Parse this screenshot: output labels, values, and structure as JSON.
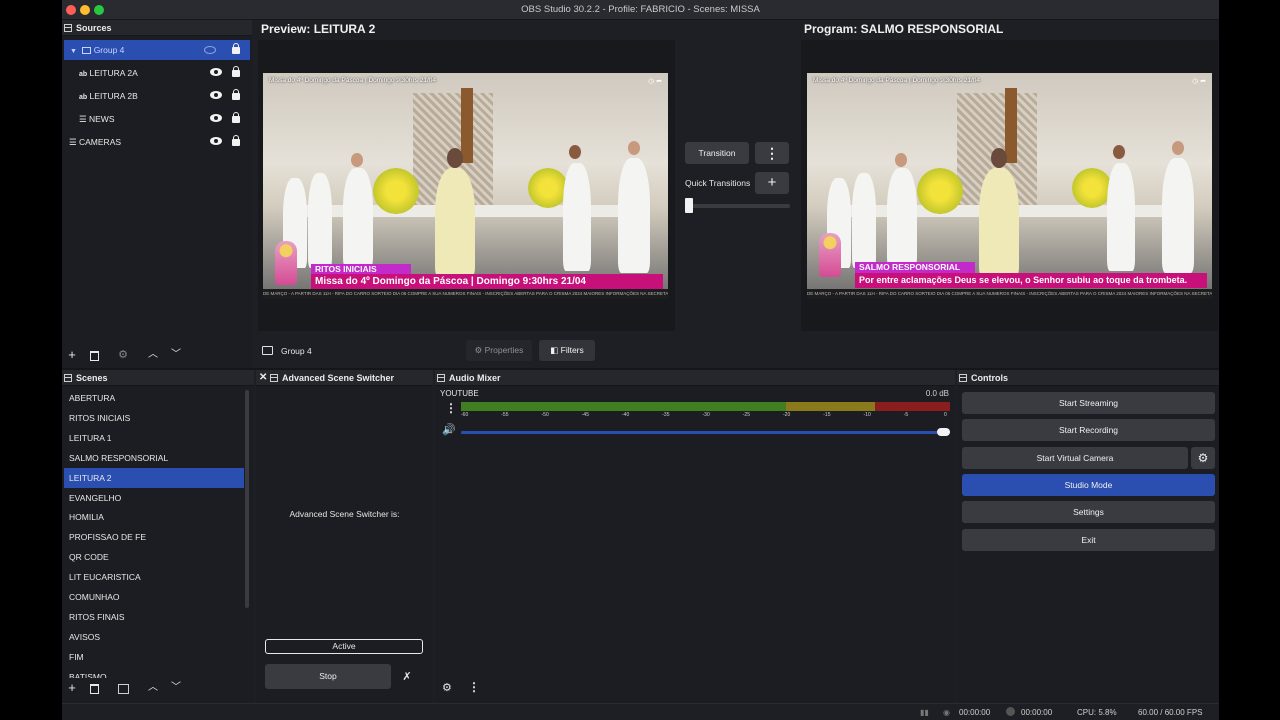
{
  "window": {
    "title": "OBS Studio 30.2.2 - Profile: FABRICIO - Scenes: MISSA"
  },
  "sources": {
    "header": "Sources",
    "items": [
      {
        "label": "Group 4",
        "type": "group"
      },
      {
        "label": "LEITURA 2A",
        "type": "text"
      },
      {
        "label": "LEITURA 2B",
        "type": "text"
      },
      {
        "label": "NEWS",
        "type": "list"
      },
      {
        "label": "CAMERAS",
        "type": "list"
      }
    ]
  },
  "preview": {
    "label": "Preview: LEITURA 2"
  },
  "program": {
    "label": "Program: SALMO RESPONSORIAL"
  },
  "video": {
    "stream_title": "Missa do 4º Domingo da Páscoa | Domingo 9:30hrs 21/04",
    "preview_bar_small": "RITOS INICIAIS",
    "preview_bar_big": "Missa do 4º Domingo da Páscoa | Domingo 9:30hrs 21/04",
    "program_bar_small": "SALMO RESPONSORIAL",
    "program_bar_big": "Por entre aclamações Deus se elevou, o Senhor subiu ao toque da trombeta.",
    "ticker": "DE MARÇO - A PARTIR DAS 11H - RIFA DO CARRO SORTEIO DIA 06 COMPRE A SUA NUMEROS FINAIS - INSCRIÇÕES ABERTAS PARA O CRISMA 2024 MAIORES INFORMAÇÕES NA SECRETARIA"
  },
  "transition": {
    "button": "Transition",
    "quick_label": "Quick Transitions"
  },
  "context_bar": {
    "source_name": "Group 4",
    "properties": "Properties",
    "filters": "Filters"
  },
  "scenes": {
    "header": "Scenes",
    "items": [
      "ABERTURA",
      "RITOS INICIAIS",
      "LEITURA 1",
      "SALMO RESPONSORIAL",
      "LEITURA 2",
      "EVANGELHO",
      "HOMILIA",
      "PROFISSAO DE FE",
      "QR CODE",
      "LIT EUCARISTICA",
      "COMUNHAO",
      "RITOS FINAIS",
      "AVISOS",
      "FIM",
      "BATISMO"
    ],
    "selected": "LEITURA 2"
  },
  "switcher": {
    "header": "Advanced Scene Switcher",
    "status_label": "Advanced Scene Switcher is:",
    "status_value": "Active",
    "stop": "Stop"
  },
  "audio": {
    "header": "Audio Mixer",
    "channel": "YOUTUBE",
    "db": "0.0 dB",
    "scale": [
      "-60",
      "-55",
      "-50",
      "-45",
      "-40",
      "-35",
      "-30",
      "-25",
      "-20",
      "-15",
      "-10",
      "-5",
      "0"
    ],
    "volume_fraction": 1.0
  },
  "controls": {
    "header": "Controls",
    "start_streaming": "Start Streaming",
    "start_recording": "Start Recording",
    "start_virtual_camera": "Start Virtual Camera",
    "studio_mode": "Studio Mode",
    "settings": "Settings",
    "exit": "Exit"
  },
  "status": {
    "stream_time": "00:00:00",
    "record_time": "00:00:00",
    "cpu": "CPU: 5.8%",
    "fps": "60.00 / 60.00 FPS"
  },
  "colors": {
    "accent": "#2b4fb0",
    "background": "#1e1f24",
    "meter_green": "#3f7f1f",
    "meter_yellow": "#8a7a1c",
    "meter_red": "#8a1e1e"
  }
}
